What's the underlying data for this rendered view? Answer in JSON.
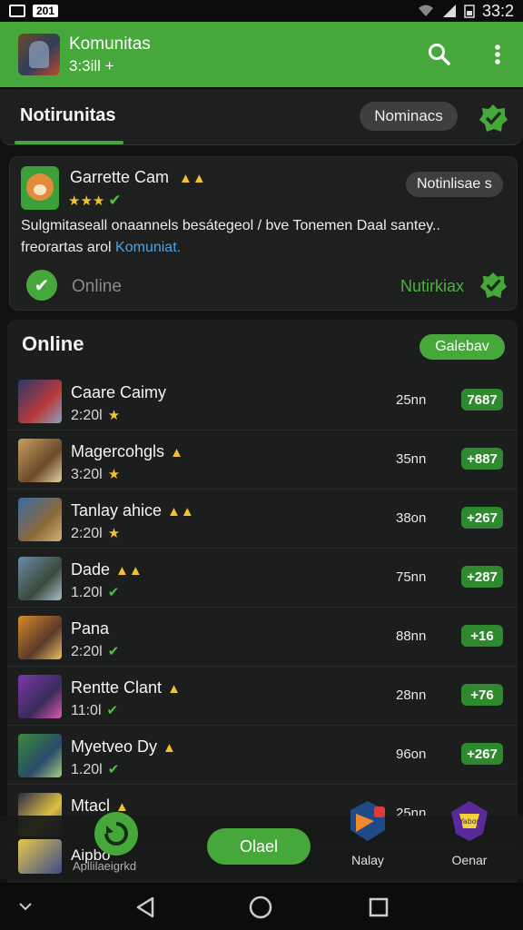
{
  "status_bar": {
    "chip_text": "201",
    "time": "33:2"
  },
  "app_bar": {
    "title": "Komunitas",
    "subtitle": "3:3ill +"
  },
  "tab_header": {
    "active_tab": "Notirunitas",
    "pill": "Nominacs"
  },
  "game_card": {
    "name": "Garrette Cam",
    "crowns": "▲▲",
    "rating": "★★★",
    "pill": "Notinlisae s",
    "description_part1": "Sulgmitaseall onaannels besátegeol / bve Tonemen Daal santey.. freorartas arol ",
    "description_link": "Komuniat.",
    "online_label": "Online",
    "action_link": "Nutirkiax"
  },
  "online_list": {
    "title": "Online",
    "pill": "Galebav",
    "rows": [
      {
        "name": "Caare Caimy",
        "crowns": "",
        "sub": "2:20l",
        "mark": "star",
        "time": "25nn",
        "score": "7687",
        "colors": [
          "#2a3a6a",
          "#b83a3a",
          "#8aa0c8"
        ]
      },
      {
        "name": "Magercohgls",
        "crowns": "▲",
        "sub": "3:20l",
        "mark": "star",
        "time": "35nn",
        "score": "+887",
        "colors": [
          "#c9a060",
          "#6a4a2a",
          "#e8d2a0"
        ]
      },
      {
        "name": "Tanlay ahice",
        "crowns": "▲▲",
        "sub": "2:20l",
        "mark": "star",
        "time": "38on",
        "score": "+267",
        "colors": [
          "#3a6aa8",
          "#8a6a3a",
          "#d8b070"
        ]
      },
      {
        "name": "Dade",
        "crowns": "▲▲",
        "sub": "1.20l",
        "mark": "tick",
        "time": "75nn",
        "score": "+287",
        "colors": [
          "#6a8aa8",
          "#3a4a3a",
          "#a8c0d0"
        ]
      },
      {
        "name": "Pana",
        "crowns": "",
        "sub": "2:20l",
        "mark": "tick",
        "time": "88nn",
        "score": "+16",
        "colors": [
          "#d88a2a",
          "#5a3a2a",
          "#f2c060"
        ]
      },
      {
        "name": "Rentte Clant",
        "crowns": "▲",
        "sub": "11:0l",
        "mark": "tick",
        "time": "28nn",
        "score": "+76",
        "colors": [
          "#7a3aa8",
          "#3a2a5a",
          "#e05ab0"
        ]
      },
      {
        "name": "Myetveo Dy",
        "crowns": "▲",
        "sub": "1.20l",
        "mark": "tick",
        "time": "96on",
        "score": "+267",
        "colors": [
          "#3a8a3a",
          "#2a4a6a",
          "#a8d080"
        ]
      },
      {
        "name": "Mtacl",
        "crowns": "▲",
        "sub": "",
        "mark": "",
        "time": "25nn",
        "score": "",
        "colors": [
          "#2a2a4a",
          "#e0c040",
          "#3a3a6a"
        ]
      }
    ]
  },
  "bottom": {
    "partial_name": "Aipbo",
    "partial_sub": "Apllilaeigrkd",
    "main_pill": "Olael",
    "nav_left_label": "Nalay",
    "nav_right_label": "Oenar",
    "emblem_text": "Yabor"
  }
}
